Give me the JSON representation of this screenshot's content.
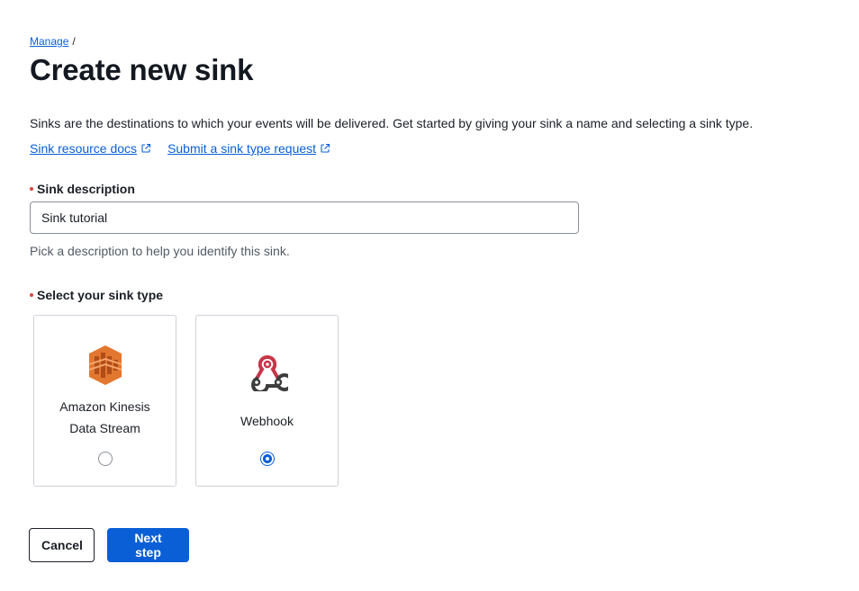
{
  "breadcrumb": {
    "link": "Manage",
    "separator": "/"
  },
  "title": "Create new sink",
  "intro": "Sinks are the destinations to which your events will be delivered. Get started by giving your sink a name and selecting a sink type.",
  "links": [
    {
      "label": "Sink resource docs",
      "icon": "external-link-icon"
    },
    {
      "label": "Submit a sink type request",
      "icon": "external-link-icon"
    }
  ],
  "description_field": {
    "label": "Sink description",
    "value": "Sink tutorial",
    "help": "Pick a description to help you identify this sink."
  },
  "sink_type": {
    "label": "Select your sink type",
    "options": [
      {
        "line1": "Amazon Kinesis",
        "line2": "Data Stream",
        "icon": "kinesis-icon",
        "selected": false
      },
      {
        "line1": "Webhook",
        "icon": "webhook-icon",
        "selected": true
      }
    ]
  },
  "actions": {
    "cancel": "Cancel",
    "next": "Next step"
  },
  "colors": {
    "accent": "#0a5fd6",
    "required": "#d9453f",
    "kinesis": "#e2772f",
    "webhook_red": "#c7354a",
    "webhook_dark": "#3d3d3d"
  }
}
